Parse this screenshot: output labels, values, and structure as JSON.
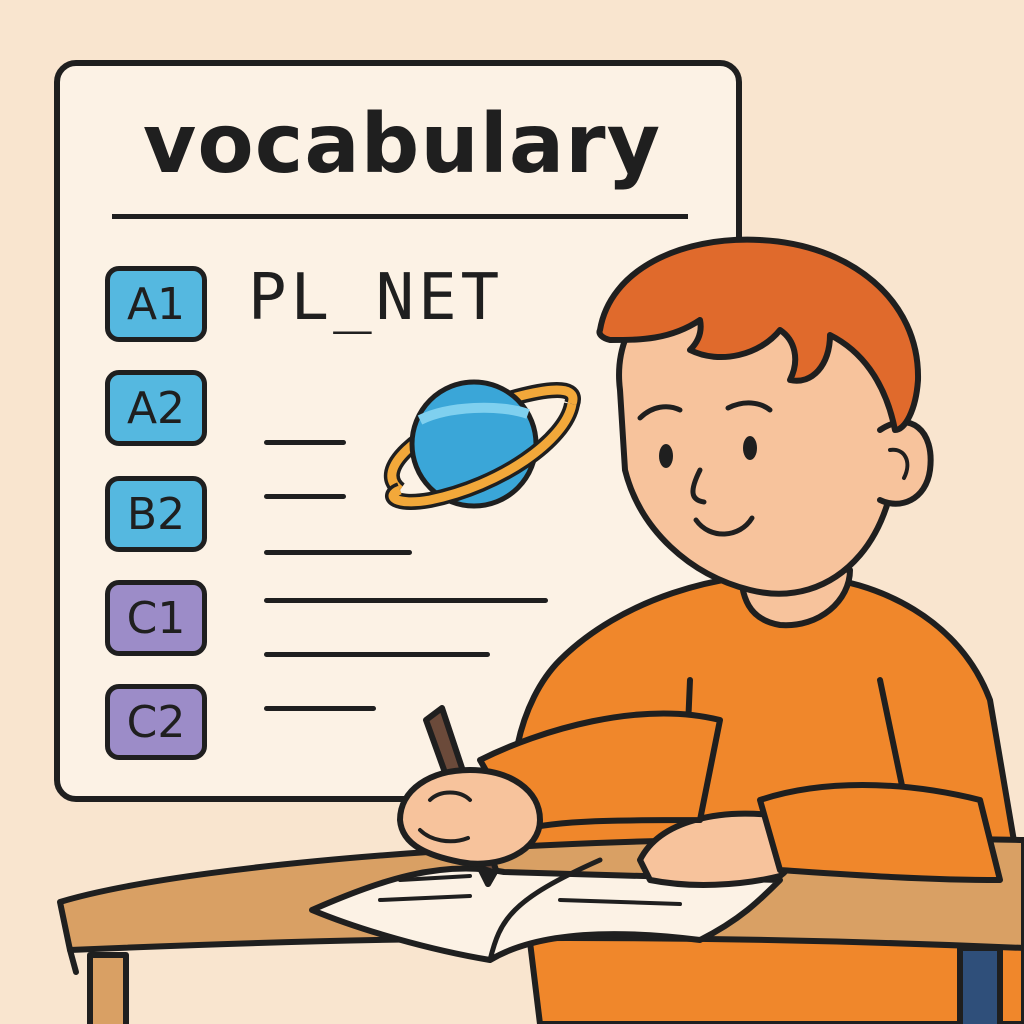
{
  "board": {
    "title": "vocabulary",
    "word": "PL_NET",
    "levels": [
      {
        "label": "A1",
        "color": "#55b8e0"
      },
      {
        "label": "A2",
        "color": "#55b8e0"
      },
      {
        "label": "B2",
        "color": "#55b8e0"
      },
      {
        "label": "C1",
        "color": "#9c8cc8"
      },
      {
        "label": "C2",
        "color": "#9c8cc8"
      }
    ],
    "icon": "planet-icon"
  },
  "colors": {
    "background": "#f9e5cf",
    "board": "#fcf2e5",
    "hair": "#e06a2c",
    "sweater": "#f0872b",
    "skin": "#f7c39c",
    "desk": "#d9a064",
    "planet": "#3aa6d8",
    "ring": "#f2a83a"
  }
}
